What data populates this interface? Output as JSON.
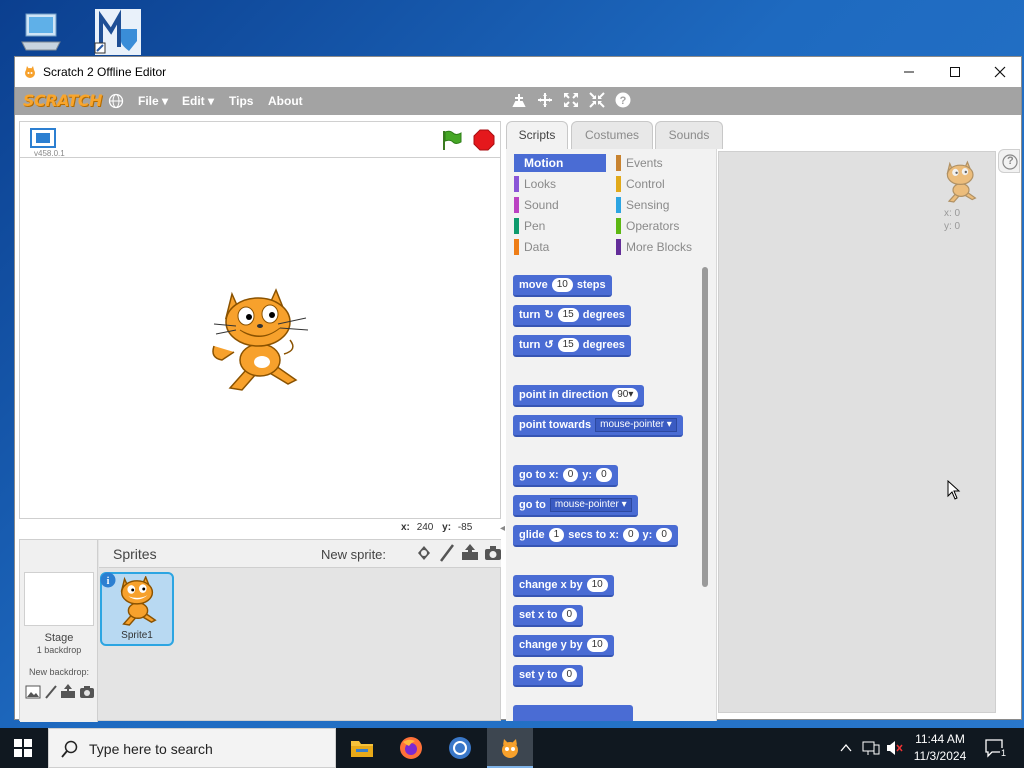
{
  "desktop": {
    "icons": [
      "this-pc-icon",
      "shortcut-icon"
    ]
  },
  "window": {
    "title": "Scratch 2 Offline Editor"
  },
  "menubar": {
    "logo": "SCRATCH",
    "file": "File",
    "edit": "Edit",
    "tips": "Tips",
    "about": "About"
  },
  "stage": {
    "version": "v458.0.1",
    "coords_x_label": "x:",
    "coords_x": "240",
    "coords_y_label": "y:",
    "coords_y": "-85"
  },
  "sprites": {
    "header": "Sprites",
    "new_sprite": "New sprite:",
    "stage_label": "Stage",
    "stage_backdrops": "1 backdrop",
    "new_backdrop": "New backdrop:",
    "sprite1_name": "Sprite1"
  },
  "tabs": {
    "scripts": "Scripts",
    "costumes": "Costumes",
    "sounds": "Sounds"
  },
  "categories": {
    "left": [
      {
        "label": "Motion",
        "color": "#4a6cd4"
      },
      {
        "label": "Looks",
        "color": "#8a55d7"
      },
      {
        "label": "Sound",
        "color": "#bb42c3"
      },
      {
        "label": "Pen",
        "color": "#0e9a6c"
      },
      {
        "label": "Data",
        "color": "#ee7d16"
      }
    ],
    "right": [
      {
        "label": "Events",
        "color": "#c88330"
      },
      {
        "label": "Control",
        "color": "#e1a91a"
      },
      {
        "label": "Sensing",
        "color": "#2ca5e2"
      },
      {
        "label": "Operators",
        "color": "#5cb712"
      },
      {
        "label": "More Blocks",
        "color": "#632d99"
      }
    ]
  },
  "blocks": {
    "move": "move",
    "move_val": "10",
    "steps": "steps",
    "turn": "turn",
    "turn_val": "15",
    "degrees": "degrees",
    "point_in_direction": "point in direction",
    "direction_val": "90▾",
    "point_towards": "point towards",
    "mouse_pointer": "mouse-pointer",
    "go_to_x": "go to x:",
    "go_x_val": "0",
    "y_label": "y:",
    "go_y_val": "0",
    "go_to": "go to",
    "glide": "glide",
    "glide_val": "1",
    "secs_to_x": "secs to x:",
    "glide_x_val": "0",
    "glide_y_val": "0",
    "change_x_by": "change x by",
    "change_x_val": "10",
    "set_x_to": "set x to",
    "set_x_val": "0",
    "change_y_by": "change y by",
    "change_y_val": "10",
    "set_y_to": "set y to",
    "set_y_val": "0"
  },
  "scriptarea": {
    "x_label": "x: 0",
    "y_label": "y: 0",
    "help": "?"
  },
  "taskbar": {
    "search_placeholder": "Type here to search",
    "time": "11:44 AM",
    "date": "11/3/2024",
    "notif_count": "1"
  }
}
